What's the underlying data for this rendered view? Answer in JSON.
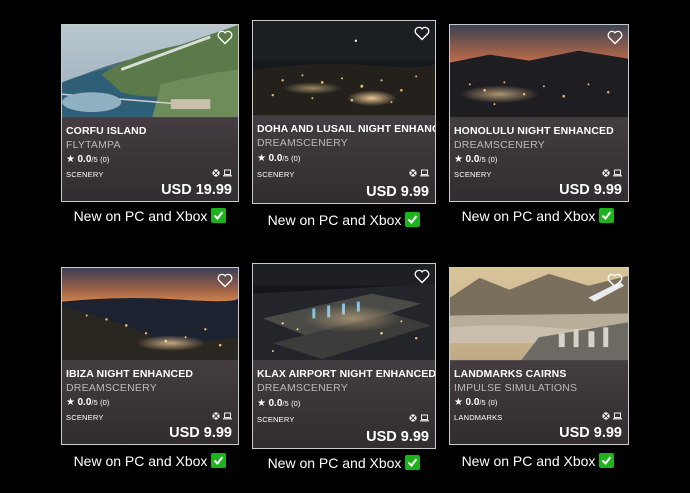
{
  "cards": [
    {
      "title": "CORFU ISLAND",
      "creator": "FLYTAMPA",
      "rating": "0.0",
      "rating_scale": "/5",
      "rating_count": "(0)",
      "category": "SCENERY",
      "price": "USD 19.99"
    },
    {
      "title": "DOHA AND LUSAIL NIGHT ENHANCED",
      "creator": "DREAMSCENERY",
      "rating": "0.0",
      "rating_scale": "/5",
      "rating_count": "(0)",
      "category": "SCENERY",
      "price": "USD 9.99"
    },
    {
      "title": "HONOLULU NIGHT ENHANCED",
      "creator": "DREAMSCENERY",
      "rating": "0.0",
      "rating_scale": "/5",
      "rating_count": "(0)",
      "category": "SCENERY",
      "price": "USD 9.99"
    },
    {
      "title": "IBIZA NIGHT ENHANCED",
      "creator": "DREAMSCENERY",
      "rating": "0.0",
      "rating_scale": "/5",
      "rating_count": "(0)",
      "category": "SCENERY",
      "price": "USD 9.99"
    },
    {
      "title": "KLAX AIRPORT NIGHT ENHANCED",
      "creator": "DREAMSCENERY",
      "rating": "0.0",
      "rating_scale": "/5",
      "rating_count": "(0)",
      "category": "SCENERY",
      "price": "USD 9.99"
    },
    {
      "title": "LANDMARKS CAIRNS",
      "creator": "IMPULSE SIMULATIONS",
      "rating": "0.0",
      "rating_scale": "/5",
      "rating_count": "(0)",
      "category": "LANDMARKS",
      "price": "USD 9.99"
    }
  ],
  "captions": [
    "New on PC and Xbox",
    "New on PC and Xbox",
    "New on PC and Xbox",
    "New on PC and Xbox",
    "New on PC and Xbox",
    "New on PC and Xbox"
  ],
  "icons": {
    "favorite": "heart-outline-icon",
    "rating": "star-icon",
    "platform_xbox": "xbox-icon",
    "platform_pc": "laptop-icon",
    "check": "green-check-icon"
  },
  "colors": {
    "background": "#000000",
    "check_green": "#1db31d",
    "card_border": "#c9c9c9"
  }
}
